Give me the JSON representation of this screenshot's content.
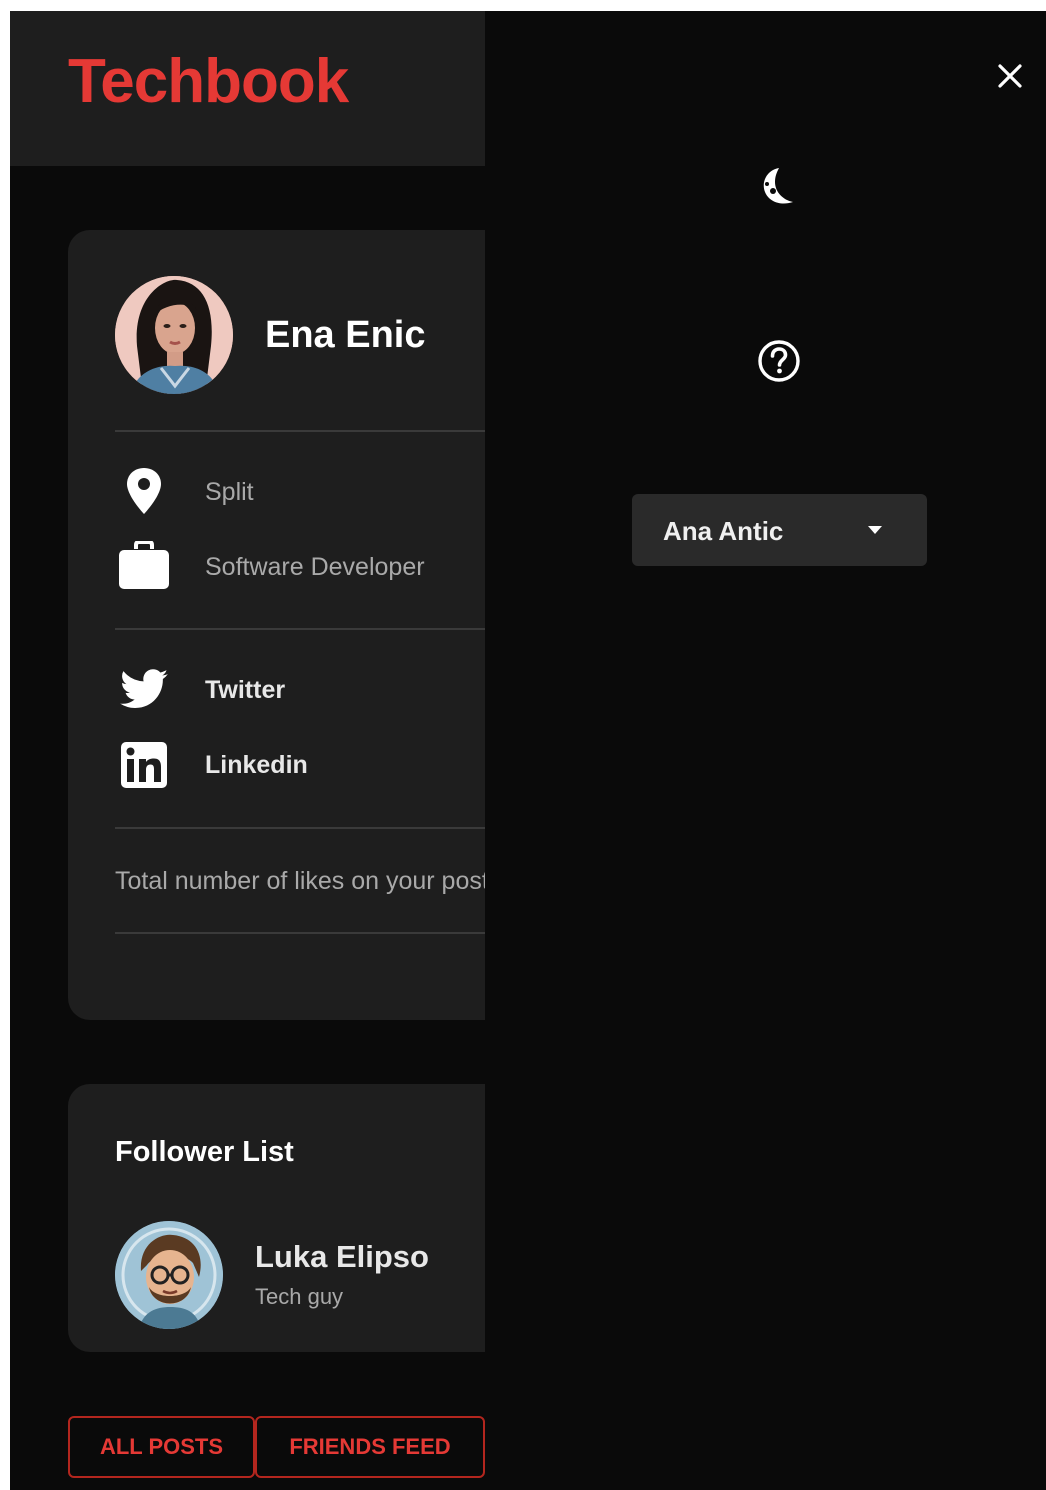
{
  "header": {
    "logo_text": "Techbook",
    "accent_color": "#e53935"
  },
  "profile": {
    "name": "Ena Enic",
    "location": "Split",
    "job": "Software Developer",
    "links": {
      "twitter": "Twitter",
      "linkedin": "Linkedin"
    },
    "likes_text": "Total number of likes on your posts"
  },
  "followers": {
    "title": "Follower List",
    "items": [
      {
        "name": "Luka Elipso",
        "subtitle": "Tech guy"
      }
    ]
  },
  "feed_tabs": {
    "all_posts": "ALL POSTS",
    "friends_feed": "FRIENDS FEED"
  },
  "drawer": {
    "close_icon": "close-icon",
    "theme_icon": "dark-mode-icon",
    "help_icon": "help-icon",
    "user_select": {
      "value": "Ana Antic"
    }
  }
}
